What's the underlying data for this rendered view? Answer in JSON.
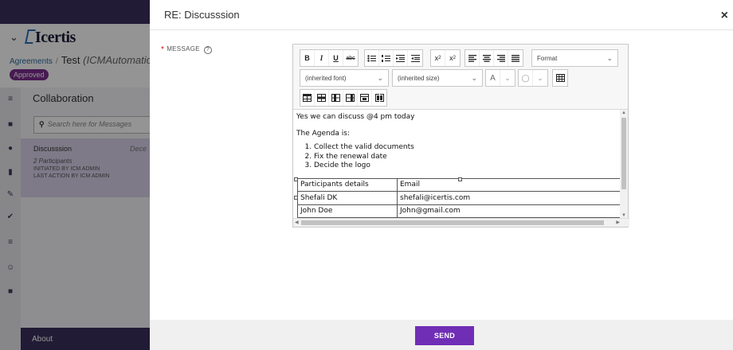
{
  "background": {
    "brand": "Icertis",
    "breadcrumb_link": "Agreements",
    "breadcrumb_record": "Test",
    "breadcrumb_suffix": "(ICMAutomatio",
    "status_badge": "Approved",
    "section_title": "Collaboration",
    "search_placeholder": "Search here for Messages",
    "thread": {
      "title": "Discusssion",
      "date": "Dece",
      "participants": "2 Participants",
      "initiated": "INITIATED BY ICM ADMIN",
      "last_action": "LAST ACTION BY ICM ADMIN"
    },
    "about": "About",
    "rail_icons": [
      "menu-icon",
      "chart-icon",
      "info-icon",
      "document-icon",
      "edit-icon",
      "check-icon",
      "list-icon",
      "people-icon",
      "archive-icon"
    ]
  },
  "modal": {
    "title": "RE: Discusssion",
    "close": "×",
    "field_label": "MESSAGE",
    "required_mark": "*",
    "help": "?",
    "toolbar": {
      "format_label": "Format",
      "font_label": "(inherited font)",
      "size_label": "(inherited size)",
      "text_color_label": "A"
    },
    "content": {
      "line1": "Yes we can discuss @4 pm today",
      "line2": "The Agenda is:",
      "agenda": [
        "Collect the valid documents",
        "Fix the renewal date",
        "Decide the logo"
      ],
      "table": [
        [
          "Participants details",
          "Email"
        ],
        [
          "Shefali DK",
          "shefali@icertis.com"
        ],
        [
          "John Doe",
          "John@gmail.com"
        ]
      ]
    },
    "send_label": "SEND"
  },
  "colors": {
    "accent": "#6f2eb5",
    "header_dark": "#3a2f5c",
    "badge": "#7b2d8e",
    "selected_thread": "#d9d2ea"
  }
}
